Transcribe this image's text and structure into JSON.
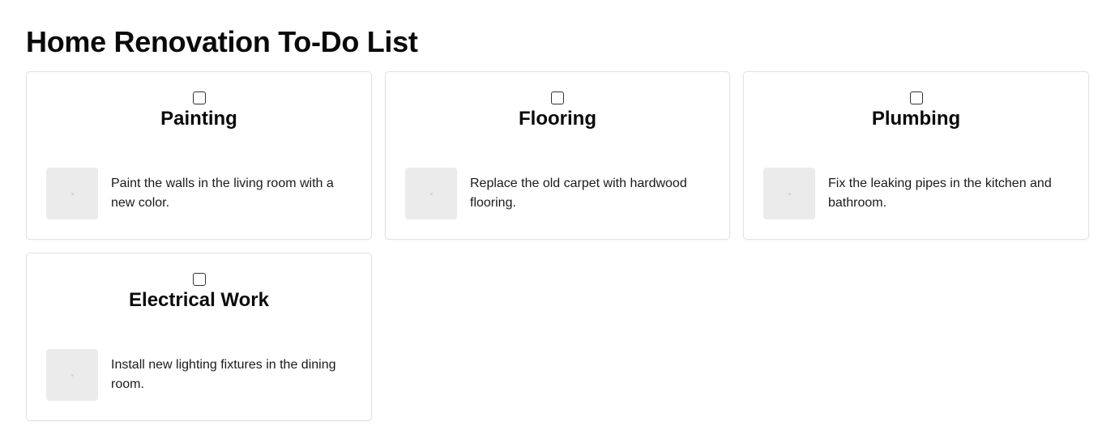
{
  "page": {
    "title": "Home Renovation To-Do List"
  },
  "tasks": [
    {
      "title": "Painting",
      "description": "Paint the walls in the living room with a new color.",
      "checked": false,
      "image_icon": "image-placeholder-icon"
    },
    {
      "title": "Flooring",
      "description": "Replace the old carpet with hardwood flooring.",
      "checked": false,
      "image_icon": "image-placeholder-icon"
    },
    {
      "title": "Plumbing",
      "description": "Fix the leaking pipes in the kitchen and bathroom.",
      "checked": false,
      "image_icon": "image-placeholder-icon"
    },
    {
      "title": "Electrical Work",
      "description": "Install new lighting fixtures in the dining room.",
      "checked": false,
      "image_icon": "image-placeholder-icon"
    }
  ],
  "colors": {
    "text": "#0a0a0a",
    "card_border": "#e2e2e2",
    "thumbnail_bg": "#ebebeb"
  }
}
